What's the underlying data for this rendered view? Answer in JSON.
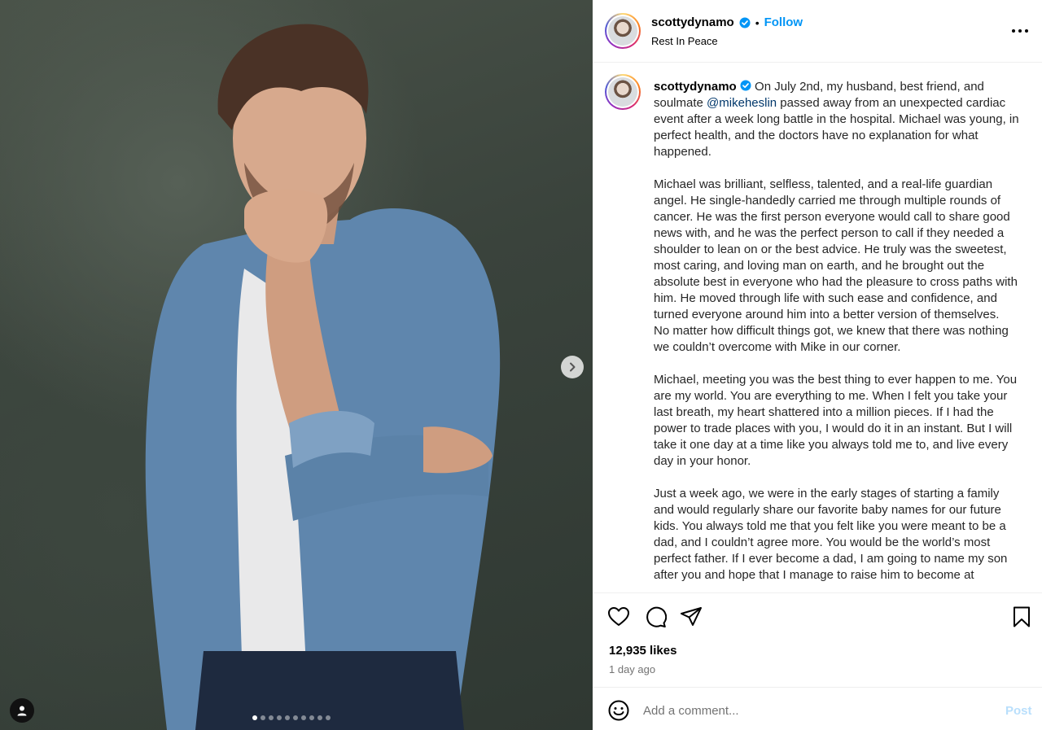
{
  "header": {
    "username": "scottydynamo",
    "separator": "•",
    "follow_label": "Follow",
    "subtitle": "Rest In Peace"
  },
  "carousel": {
    "slide_count": 10,
    "active_index": 0
  },
  "caption": {
    "username": "scottydynamo",
    "text_before_mention": "On July 2nd, my husband, best friend, and soulmate ",
    "mention": "@mikeheslin",
    "text_after_mention": " passed away from an unexpected cardiac event after a week long battle in the hospital. Michael was young, in perfect health, and the doctors have no explanation for what happened.\n\nMichael was brilliant, selfless, talented, and a real-life guardian angel. He single-handedly carried me through multiple rounds of cancer. He was the first person everyone would call to share good news with, and he was the perfect person to call if they needed a shoulder to lean on or the best advice. He truly was the sweetest, most caring, and loving man on earth, and he brought out the absolute best in everyone who had the pleasure to cross paths with him. He moved through life with such ease and confidence, and turned everyone around him into a better version of themselves.\nNo matter how difficult things got, we knew that there was nothing we couldn’t overcome with Mike in our corner.\n\nMichael, meeting you was the best thing to ever happen to me. You are my world. You are everything to me. When I felt you take your last breath, my heart shattered into a million pieces. If I had the power to trade places with you, I would do it in an instant. But I will take it one day at a time like you always told me to, and live every day in your honor.\n\nJust a week ago, we were in the early stages of starting a family and would regularly share our favorite baby names for our future kids. You always told me that you felt like you were meant to be a dad, and I couldn’t agree more. You would be the world’s most perfect father. If I ever become a dad, I am going to name my son after you and hope that I manage to raise him to become at"
  },
  "actions": {
    "like_icon": "heart-icon",
    "comment_icon": "comment-icon",
    "share_icon": "share-icon",
    "save_icon": "bookmark-icon",
    "likes_text": "12,935 likes",
    "time_text": "1 day ago"
  },
  "comment": {
    "placeholder": "Add a comment...",
    "post_label": "Post"
  },
  "colors": {
    "accent": "#0095f6",
    "mention": "#00376b",
    "muted": "#737373",
    "post_disabled": "#b9dffc"
  }
}
